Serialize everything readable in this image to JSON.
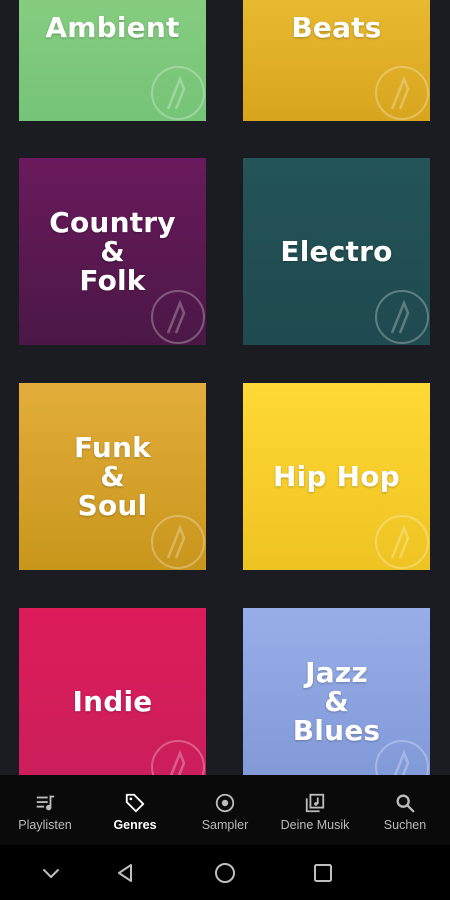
{
  "genres": [
    {
      "id": "ambient",
      "label": "Ambient"
    },
    {
      "id": "beats",
      "label": "Beats"
    },
    {
      "id": "country-folk",
      "label": "Country\n&\nFolk"
    },
    {
      "id": "electro",
      "label": "Electro"
    },
    {
      "id": "funk-soul",
      "label": "Funk\n&\nSoul"
    },
    {
      "id": "hip-hop",
      "label": "Hip Hop"
    },
    {
      "id": "indie",
      "label": "Indie"
    },
    {
      "id": "jazz-blues",
      "label": "Jazz\n&\nBlues"
    }
  ],
  "tabbar": {
    "active": "Genres",
    "tabs": [
      {
        "label": "Playlisten",
        "icon": "playlist-icon"
      },
      {
        "label": "Genres",
        "icon": "tag-icon"
      },
      {
        "label": "Sampler",
        "icon": "disc-icon"
      },
      {
        "label": "Deine Musik",
        "icon": "library-icon"
      },
      {
        "label": "Suchen",
        "icon": "search-icon"
      }
    ]
  },
  "system_nav": {
    "buttons": [
      "chevron-down-icon",
      "back-icon",
      "home-icon",
      "recents-icon"
    ]
  },
  "colors": {
    "background": "#1b1b22",
    "tabbar": "#0a0a0a",
    "active_tab": "#ffffff",
    "inactive_tab": "#bbbbbb"
  }
}
